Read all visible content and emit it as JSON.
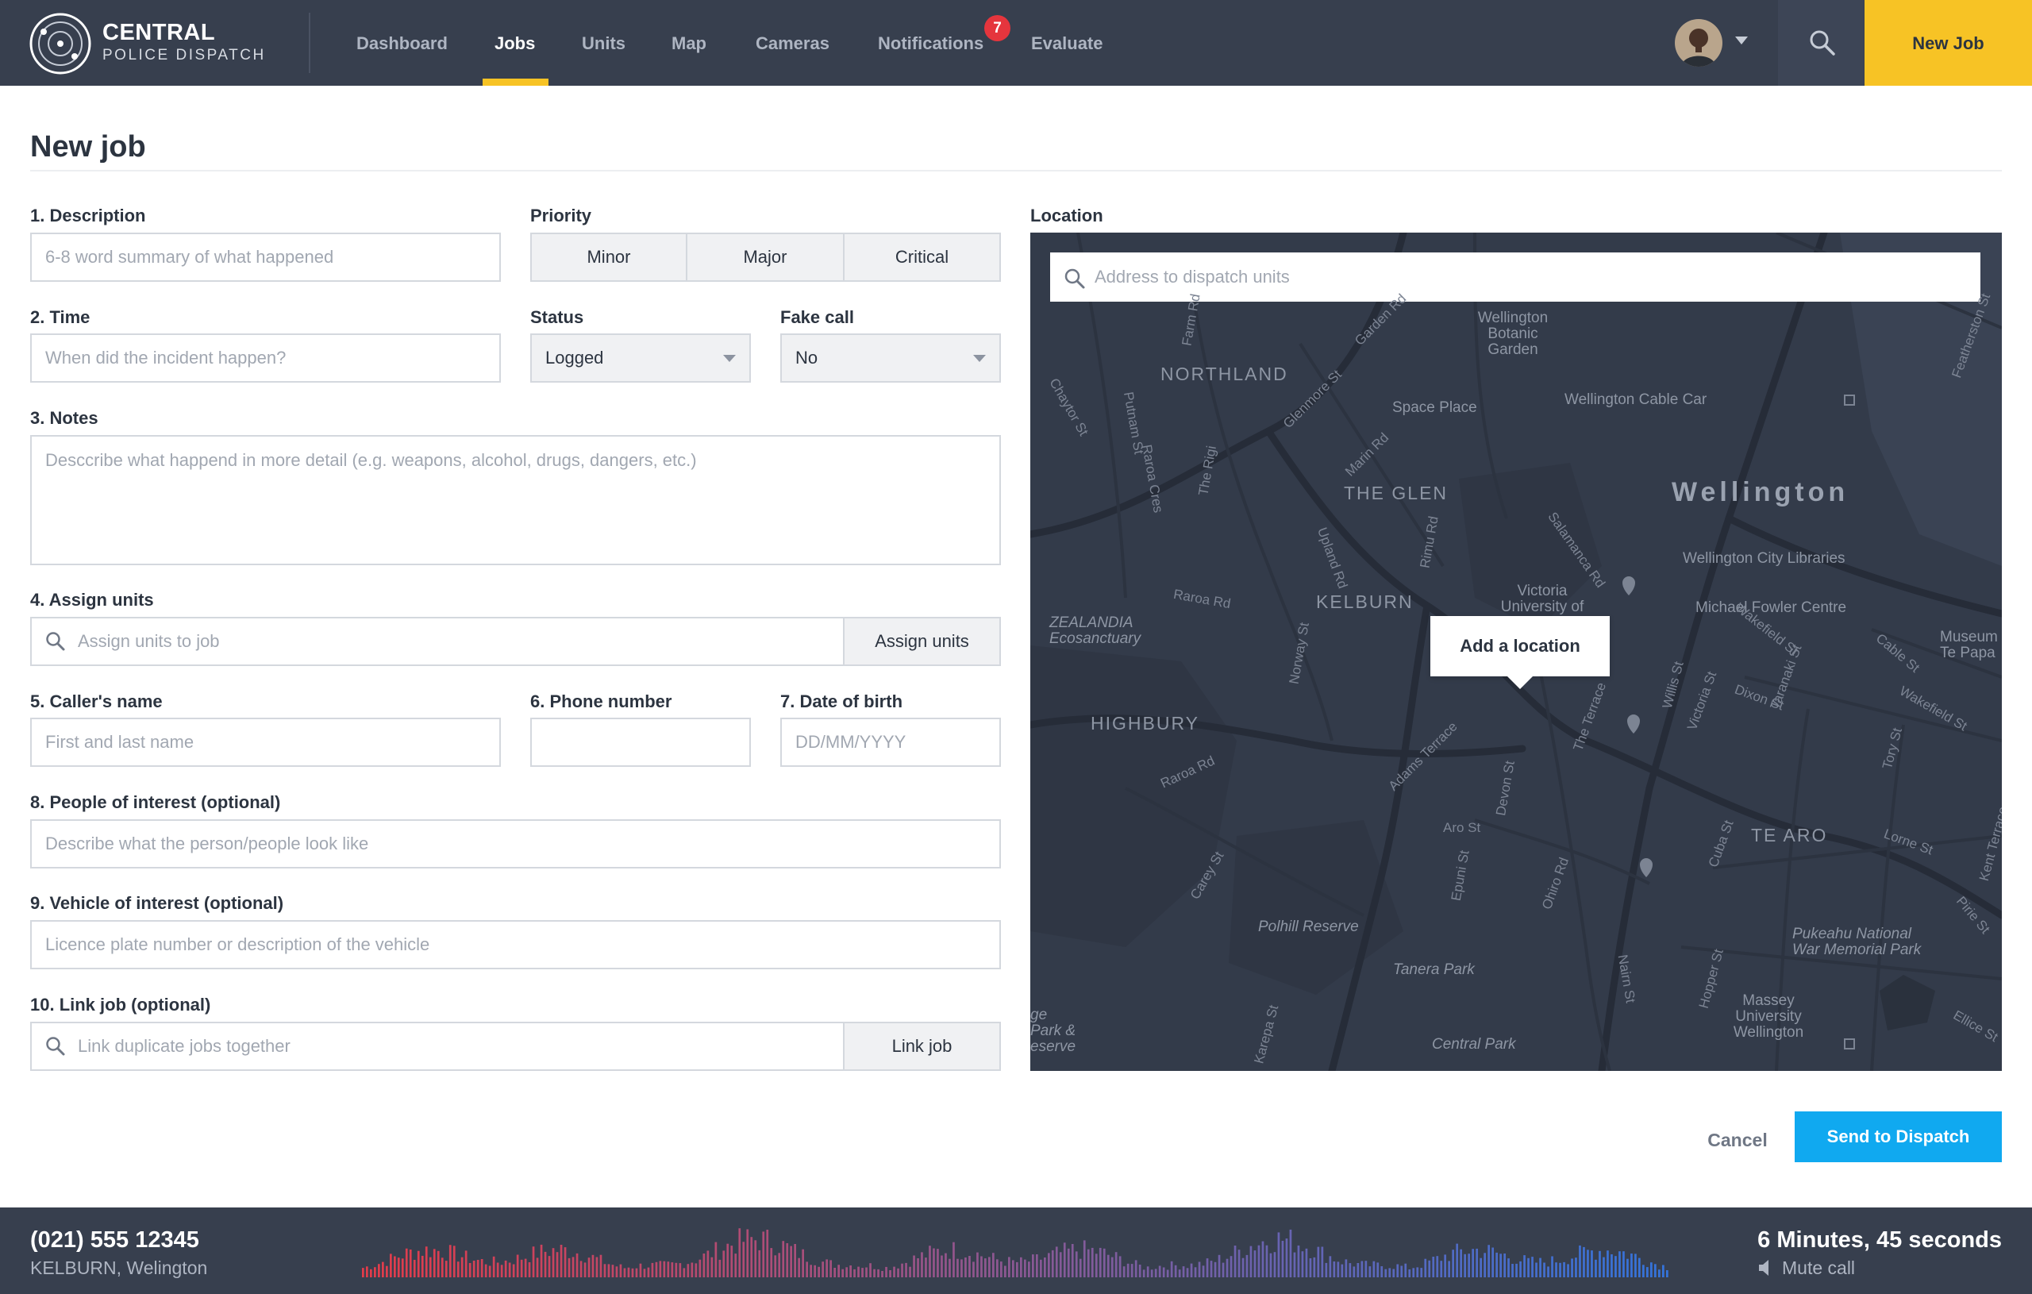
{
  "nav": {
    "brand_title": "CENTRAL",
    "brand_subtitle": "POLICE DISPATCH",
    "items": [
      "Dashboard",
      "Jobs",
      "Units",
      "Map",
      "Cameras",
      "Notifications",
      "Evaluate"
    ],
    "active_item": "Jobs",
    "notifications_count": "7",
    "new_job_label": "New Job",
    "accent_color": "#f7c325"
  },
  "page": {
    "title": "New job"
  },
  "form": {
    "description": {
      "label": "1. Description",
      "placeholder": "6-8 word summary of what happened"
    },
    "priority": {
      "label": "Priority",
      "options": [
        "Minor",
        "Major",
        "Critical"
      ]
    },
    "time": {
      "label": "2. Time",
      "placeholder": "When did the incident happen?"
    },
    "status": {
      "label": "Status",
      "value": "Logged"
    },
    "fake_call": {
      "label": "Fake call",
      "value": "No"
    },
    "notes": {
      "label": "3. Notes",
      "placeholder": "Desccribe what happend in more detail (e.g. weapons, alcohol, drugs, dangers, etc.)"
    },
    "assign_units": {
      "label": "4. Assign units",
      "placeholder": "Assign units to job",
      "button": "Assign units"
    },
    "caller_name": {
      "label": "5. Caller's name",
      "placeholder": "First and last name"
    },
    "phone": {
      "label": "6. Phone number",
      "placeholder": ""
    },
    "dob": {
      "label": "7. Date of birth",
      "placeholder": "DD/MM/YYYY"
    },
    "people": {
      "label": "8. People of interest (optional)",
      "placeholder": "Describe what the person/people look like"
    },
    "vehicle": {
      "label": "9. Vehicle of interest (optional)",
      "placeholder": "Licence plate number or description of the vehicle"
    },
    "link_job": {
      "label": "10. Link job (optional)",
      "placeholder": "Link duplicate jobs together",
      "button": "Link job"
    }
  },
  "location": {
    "label": "Location",
    "search_placeholder": "Address to dispatch units",
    "popup": "Add a location",
    "map_labels": {
      "northland": "NORTHLAND",
      "the_glen": "THE GLEN",
      "kelburn": "KELBURN",
      "highbury": "HIGHBURY",
      "te_aro": "TE ARO",
      "wellington": "Wellington",
      "space_place": "Space Place",
      "cable_car": "Wellington Cable Car",
      "botanic_garden": "Wellington Botanic Garden",
      "city_libraries": "Wellington City Libraries",
      "michael_fowler": "Michael Fowler Centre",
      "museum": "Museum Te Papa",
      "zealandia": "ZEALANDIA Ecosanctuary",
      "victoria_uni": "Victoria University of",
      "polhill": "Polhill Reserve",
      "tanera": "Tanera Park",
      "central_park": "Central Park",
      "pukeahu": "Pukeahu National War Memorial Park",
      "massey": "Massey University Wellington",
      "gepark": "ge Park & eserve"
    },
    "streets": {
      "upland": "Upland Rd",
      "glenmore": "Glenmore St",
      "salamanca": "Salamanca Rd",
      "raroa_rd": "Raroa Rd",
      "willis": "Willis St",
      "victoria": "Victoria St",
      "cuba": "Cuba St",
      "taranaki": "Taranaki St",
      "aro": "Aro St",
      "epuni": "Epuni St",
      "devon": "Devon St",
      "ohiro": "Ohiro Rd",
      "dixon": "Dixon St",
      "wakefield": "Wakefield St",
      "lorne": "Lorne St",
      "kent": "Kent Terrace",
      "adams": "Adams Terrace",
      "the_terrace": "The Terrace",
      "putnam": "Putnam St",
      "rimu": "Rimu Rd",
      "the_rigi": "The Rigi",
      "raroa_cres": "Raroa Cres",
      "chaytor": "Chaytor St",
      "farm": "Farm Rd",
      "garden": "Garden Rd",
      "marin": "Marin Rd",
      "norway": "Norway St",
      "hopper": "Hopper St",
      "nairn": "Nairn St",
      "cable": "Cable St",
      "tory": "Tory St",
      "pirie": "Pirie St",
      "ellice": "Ellice St",
      "carey": "Carey St",
      "karepa": "Karepa St",
      "featherston": "Featherston St"
    }
  },
  "actions": {
    "cancel": "Cancel",
    "send": "Send to Dispatch",
    "send_color": "#10a9f0"
  },
  "call": {
    "phone": "(021) 555 12345",
    "location": "KELBURN, Welington",
    "duration": "6 Minutes, 45 seconds",
    "mute": "Mute call"
  }
}
